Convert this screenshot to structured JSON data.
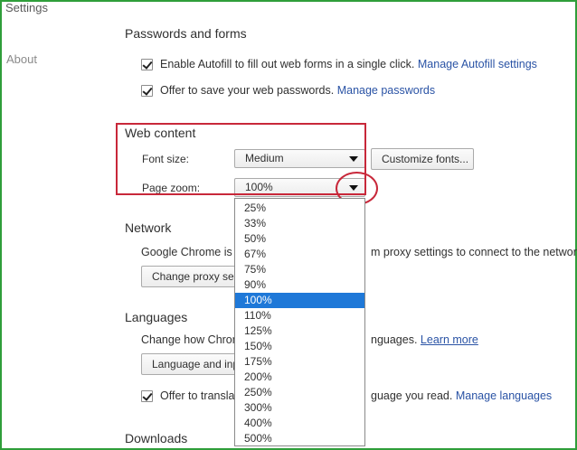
{
  "sidebar": {
    "title": "Settings",
    "about": "About"
  },
  "passwords": {
    "heading": "Passwords and forms",
    "autofill_text": "Enable Autofill to fill out web forms in a single click.",
    "autofill_link": "Manage Autofill settings",
    "passwords_text": "Offer to save your web passwords.",
    "passwords_link": "Manage passwords"
  },
  "web_content": {
    "heading": "Web content",
    "font_size_label": "Font size:",
    "font_size_value": "Medium",
    "customize_button": "Customize fonts...",
    "page_zoom_label": "Page zoom:",
    "page_zoom_value": "100%"
  },
  "network": {
    "heading": "Network",
    "text_left": "Google Chrome is u",
    "text_right": "m proxy settings to connect to the network.",
    "proxy_button": "Change proxy set"
  },
  "languages": {
    "heading": "Languages",
    "text_left": "Change how Chrom",
    "text_right": "nguages.",
    "learn_more": "Learn more",
    "lang_button": "Language and inp",
    "translate_left": "Offer to translat",
    "translate_right": "guage you read.",
    "manage_link": "Manage languages"
  },
  "downloads": {
    "heading": "Downloads"
  },
  "zoom_options": [
    "25%",
    "33%",
    "50%",
    "67%",
    "75%",
    "90%",
    "100%",
    "110%",
    "125%",
    "150%",
    "175%",
    "200%",
    "250%",
    "300%",
    "400%",
    "500%"
  ],
  "colors": {
    "link": "#2a53a5",
    "highlight": "#1e78d8",
    "annotation": "#c8283a",
    "frame": "#2f9e3a"
  }
}
